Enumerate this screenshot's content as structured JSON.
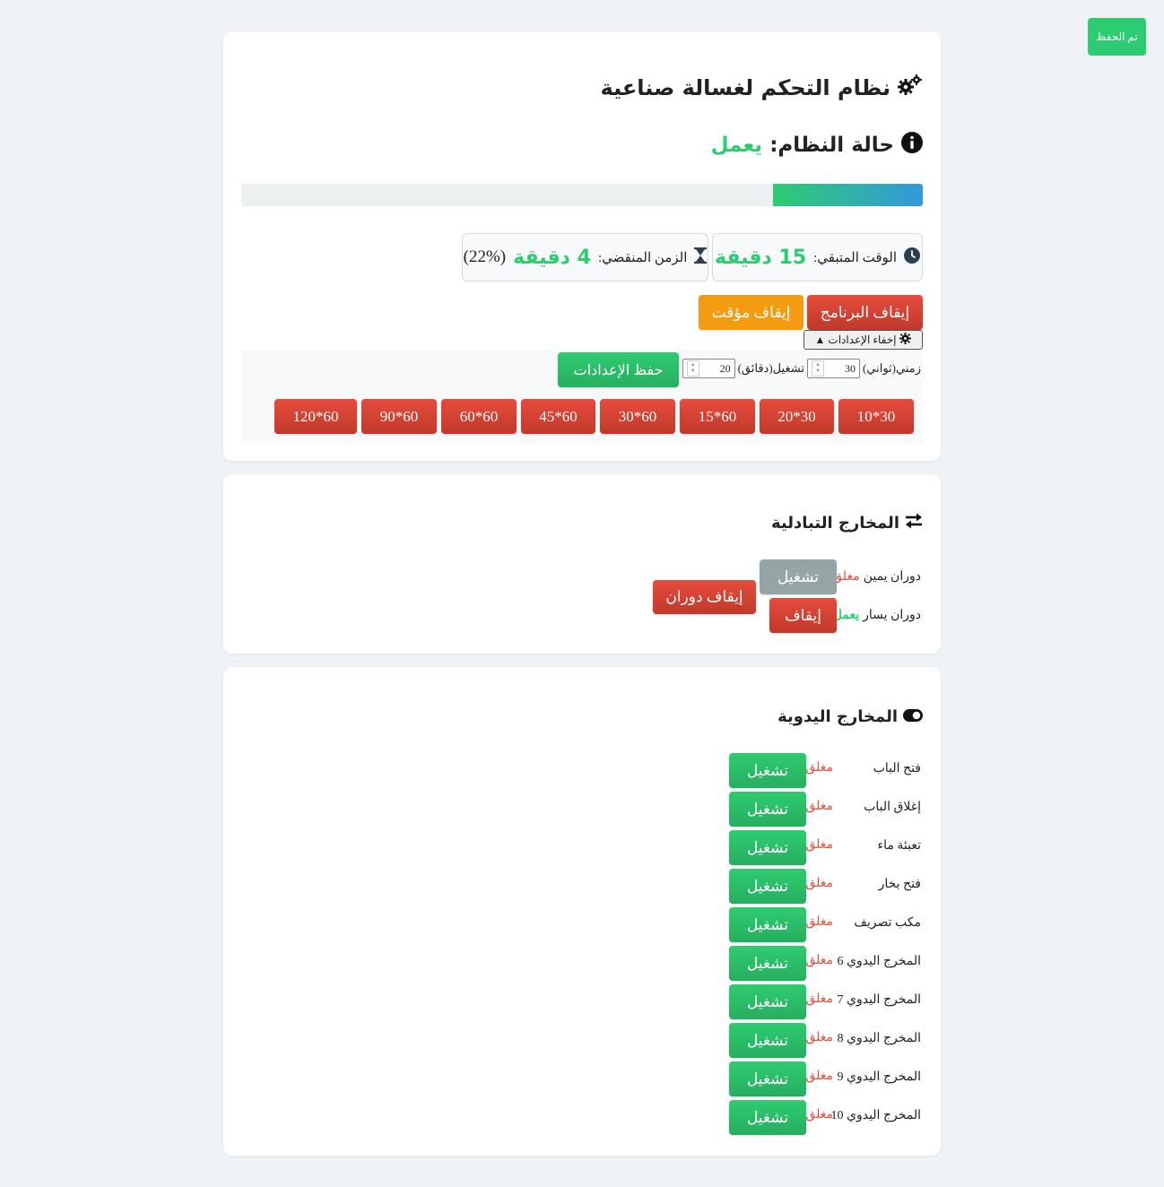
{
  "toast": "تم الحفظ",
  "header": {
    "title": "نظام التحكم لغسالة صناعية"
  },
  "status": {
    "label": "حالة النظام:",
    "value": "يعمل"
  },
  "progress": {
    "fraction": 0.22
  },
  "remaining": {
    "label": "الوقت المتبقي:",
    "value": "15 دقيقة"
  },
  "elapsed": {
    "label": "الزمن المنقضي:",
    "value": "4 دقيقة",
    "percent": "(22%)"
  },
  "controls": {
    "stop_program": "إيقاف البرنامج",
    "pause": "إيقاف مؤقت",
    "toggle_settings": "إخفاء الإعدادات ▲"
  },
  "settings": {
    "off_time_label": "زمني(ثواني)",
    "off_time_value": "30",
    "on_time_label": "تشغيل(دقائق)",
    "on_time_value": "20",
    "save": "حفظ الإعدادات",
    "presets": [
      "10*30",
      "20*30",
      "15*60",
      "30*60",
      "45*60",
      "60*60",
      "90*60",
      "120*60"
    ]
  },
  "alternating": {
    "title": "المخارج التبادلية",
    "right": {
      "label": "دوران يمين",
      "state": "مغلق",
      "button": "تشغيل"
    },
    "left": {
      "label": "دوران يسار",
      "state": "يعمل",
      "button": "إيقاف"
    },
    "stop_rotation": "إيقاف دوران"
  },
  "manual": {
    "title": "المخارج اليدوية",
    "items": [
      {
        "label": "فتح الباب",
        "state": "مغلق",
        "button": "تشغيل"
      },
      {
        "label": "إغلاق الباب",
        "state": "مغلق",
        "button": "تشغيل"
      },
      {
        "label": "تعبئة ماء",
        "state": "مغلق",
        "button": "تشغيل"
      },
      {
        "label": "فتح بخار",
        "state": "مغلق",
        "button": "تشغيل"
      },
      {
        "label": "مكب تصريف",
        "state": "مغلق",
        "button": "تشغيل"
      },
      {
        "label": "المخرج اليدوي 6",
        "state": "مغلق",
        "button": "تشغيل"
      },
      {
        "label": "المخرج اليدوي 7",
        "state": "مغلق",
        "button": "تشغيل"
      },
      {
        "label": "المخرج اليدوي 8",
        "state": "مغلق",
        "button": "تشغيل"
      },
      {
        "label": "المخرج اليدوي 9",
        "state": "مغلق",
        "button": "تشغيل"
      },
      {
        "label": "المخرج اليدوي 10",
        "state": "مغلق",
        "button": "تشغيل"
      }
    ]
  }
}
